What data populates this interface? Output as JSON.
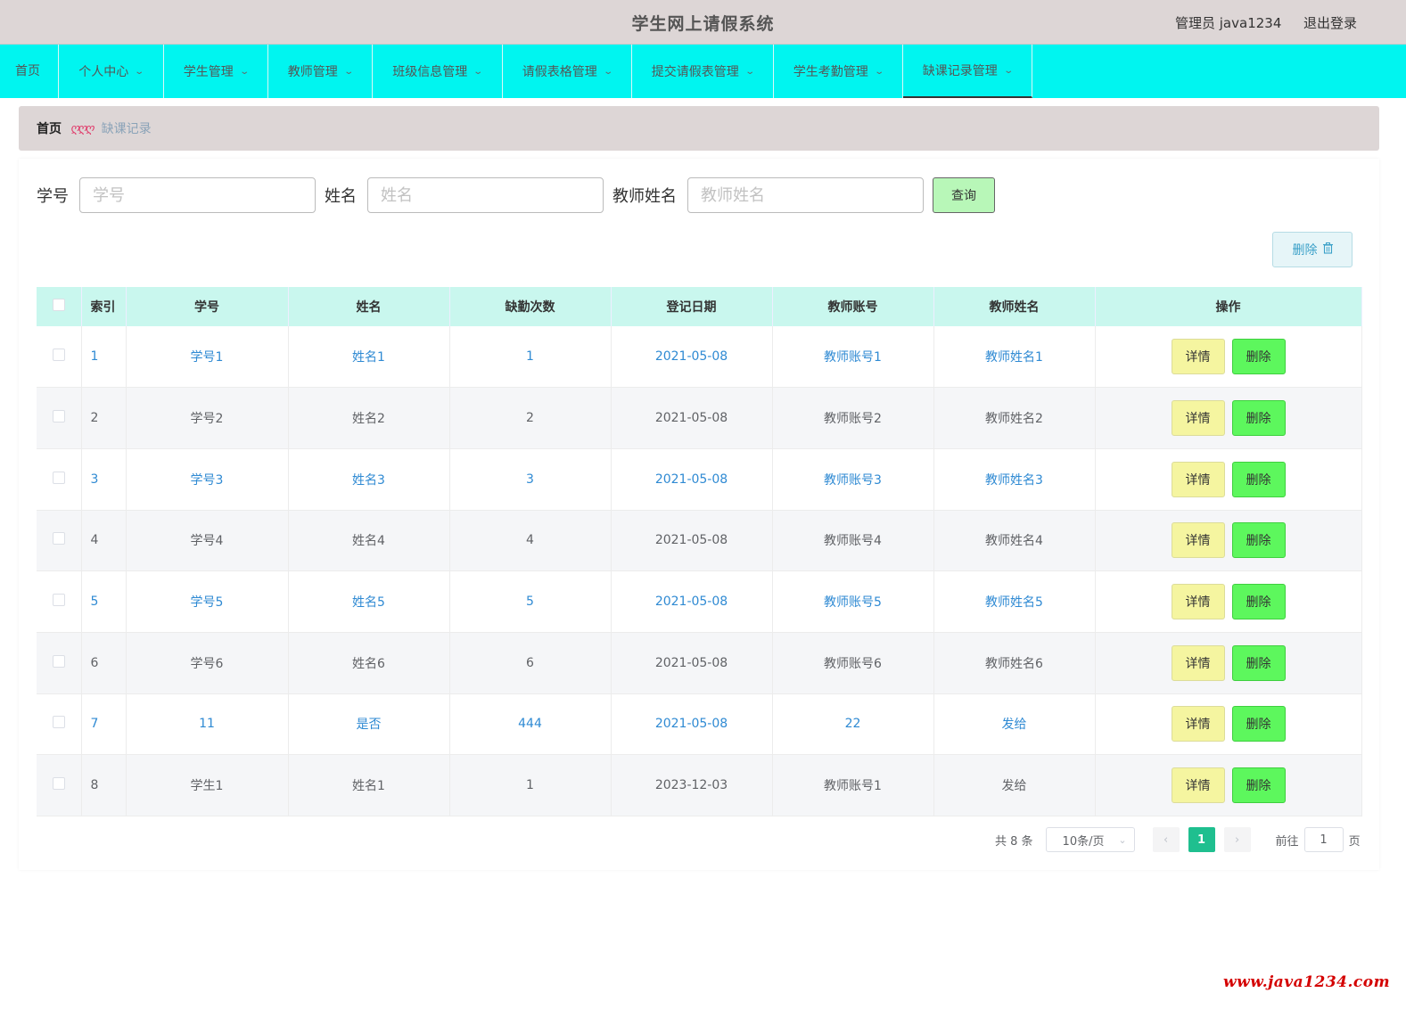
{
  "header": {
    "title": "学生网上请假系统",
    "user": "管理员 java1234",
    "logout": "退出登录"
  },
  "nav": {
    "home": "首页",
    "items": [
      "个人中心",
      "学生管理",
      "教师管理",
      "班级信息管理",
      "请假表格管理",
      "提交请假表管理",
      "学生考勤管理",
      "缺课记录管理"
    ],
    "active": "缺课记录管理"
  },
  "breadcrumb": {
    "home": "首页",
    "separator": "ღღღ",
    "current": "缺课记录"
  },
  "search": {
    "student_no_label": "学号",
    "student_no_placeholder": "学号",
    "name_label": "姓名",
    "name_placeholder": "姓名",
    "teacher_name_label": "教师姓名",
    "teacher_name_placeholder": "教师姓名",
    "query_button": "查询"
  },
  "batch_delete": "删除",
  "table": {
    "headers": [
      "索引",
      "学号",
      "姓名",
      "缺勤次数",
      "登记日期",
      "教师账号",
      "教师姓名",
      "操作"
    ],
    "rows": [
      [
        "1",
        "学号1",
        "姓名1",
        "1",
        "2021-05-08",
        "教师账号1",
        "教师姓名1"
      ],
      [
        "2",
        "学号2",
        "姓名2",
        "2",
        "2021-05-08",
        "教师账号2",
        "教师姓名2"
      ],
      [
        "3",
        "学号3",
        "姓名3",
        "3",
        "2021-05-08",
        "教师账号3",
        "教师姓名3"
      ],
      [
        "4",
        "学号4",
        "姓名4",
        "4",
        "2021-05-08",
        "教师账号4",
        "教师姓名4"
      ],
      [
        "5",
        "学号5",
        "姓名5",
        "5",
        "2021-05-08",
        "教师账号5",
        "教师姓名5"
      ],
      [
        "6",
        "学号6",
        "姓名6",
        "6",
        "2021-05-08",
        "教师账号6",
        "教师姓名6"
      ],
      [
        "7",
        "11",
        "是否",
        "444",
        "2021-05-08",
        "22",
        "发给"
      ],
      [
        "8",
        "学生1",
        "姓名1",
        "1",
        "2023-12-03",
        "教师账号1",
        "发给"
      ]
    ],
    "detail_button": "详情",
    "delete_button": "删除"
  },
  "pagination": {
    "total": "共 8 条",
    "page_size": "10条/页",
    "current_page": "1",
    "goto_label": "前往",
    "goto_value": "1",
    "page_suffix": "页"
  },
  "watermark": "www.java1234.com",
  "colors": {
    "header_bg": "#ddd6d6",
    "nav_bg": "#00f5f0",
    "table_header_bg": "#c9f7ee",
    "link_blue": "#2f8ad3",
    "detail_btn": "#f5f5a0",
    "delete_btn": "#5df75d",
    "page_active": "#1fbf8f"
  },
  "icons": [
    "chevron-down-icon",
    "trash-icon",
    "chevron-left-icon",
    "chevron-right-icon"
  ]
}
